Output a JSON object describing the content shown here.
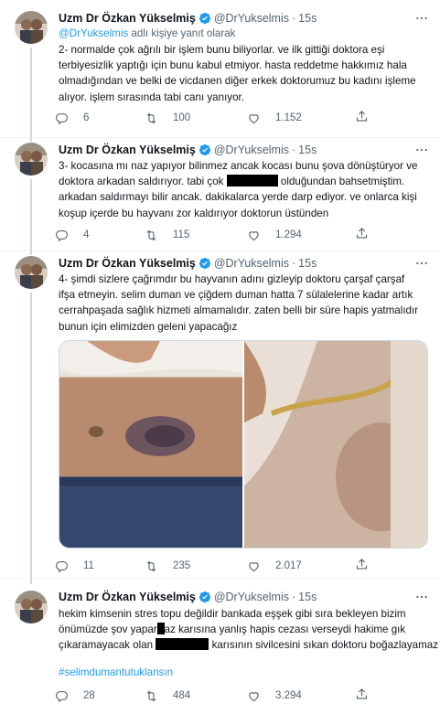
{
  "author": {
    "name": "Uzm Dr Özkan Yükselmiş",
    "handle": "@DrYukselmis",
    "separator": "·"
  },
  "colors": {
    "accent": "#1d9bf0",
    "text": "#0f1419",
    "muted": "#536471",
    "divider": "#eff3f4"
  },
  "icons": {
    "verified": "verified-badge-icon",
    "more": "more-options-icon",
    "reply": "reply-icon",
    "retweet": "retweet-icon",
    "like": "heart-icon",
    "share": "share-icon"
  },
  "tweets": [
    {
      "time": "15s",
      "reply_to": {
        "mention": "@DrYukselmis",
        "suffix": " adlı kişiye yanıt olarak"
      },
      "lines": [
        "2- normalde çok ağrılı bir işlem bunu biliyorlar. ve ilk gittiği doktora eşi",
        "terbiyesizlik yaptığı için bunu kabul etmiyor. hasta reddetme hakkımız hala",
        "olmadığından ve belki de vicdanen diğer erkek doktorumuz bu kadını işleme",
        "alıyor. işlem sırasında tabi canı yanıyor."
      ],
      "replies": "6",
      "retweets": "100",
      "likes": "1.152"
    },
    {
      "time": "15s",
      "lines": [
        "3- kocasına mı naz yapıyor bilinmez ancak kocası bunu şova dönüştüryor ve",
        "doktora arkadan saldırıyor. tabi çok",
        "olduğundan bahsetmiştim.",
        "arkadan saldırmayı bilir ancak. dakikalarca yerde darp ediyor. ve onlarca kişi",
        "koşup içerde bu hayvanı zor kaldırıyor doktorun üstünden"
      ],
      "replies": "4",
      "retweets": "115",
      "likes": "1.294"
    },
    {
      "time": "15s",
      "lines": [
        "4- şimdi sizlere çağrımdır bu hayvanın adını gizleyip doktoru çarşaf çarşaf",
        "ifşa etmeyin. selim duman ve çiğdem duman hatta 7 sülalelerine kadar artık",
        "cerrahpaşada sağlık hizmeti almamalıdır. zaten belli bir süre hapis yatmalıdır",
        "bunun için elimizden geleni yapacağız"
      ],
      "replies": "11",
      "retweets": "235",
      "likes": "2.017"
    },
    {
      "time": "15s",
      "lines": [
        "hekim kimsenin stres topu değildir bankada eşşek gibi sıra bekleyen bizim",
        "önümüzde şov yapar",
        "az karısına yanlış hapis cezası verseydi hakime gık",
        "çıkaramayacak olan",
        "karısının sivilcesini sıkan doktoru boğazlayamaz"
      ],
      "hashtag": "#selimdumantutuklansın",
      "replies": "28",
      "retweets": "484",
      "likes": "3.294"
    }
  ]
}
